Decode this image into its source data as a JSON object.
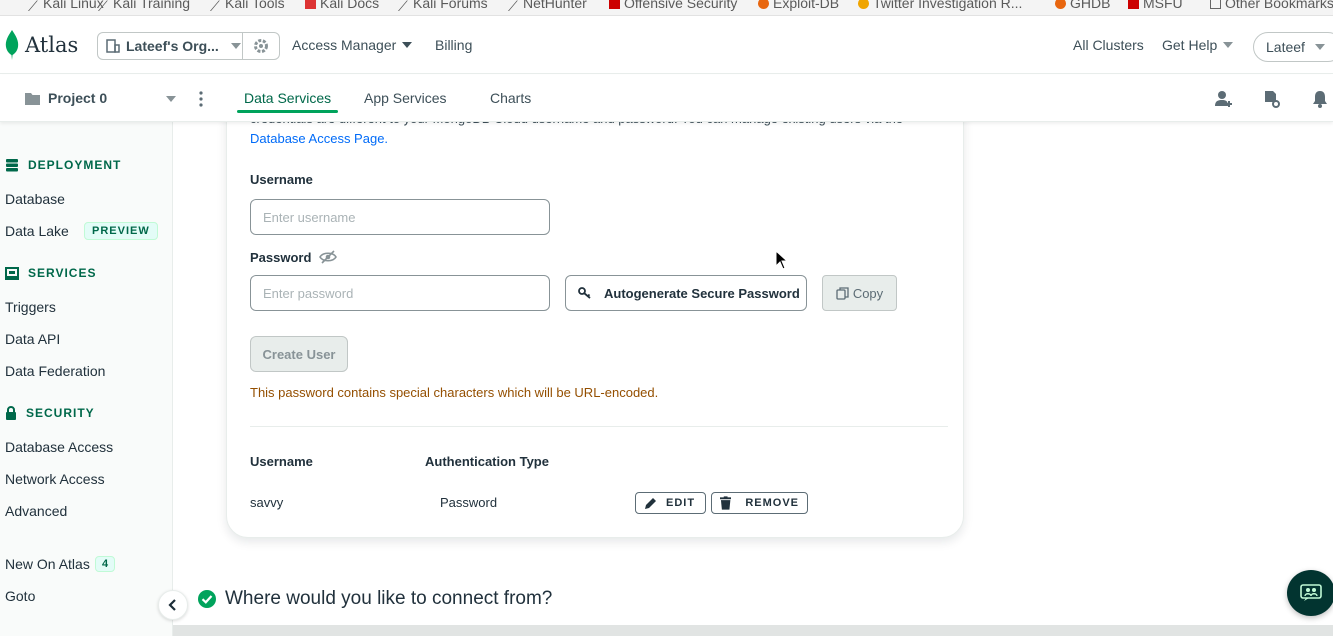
{
  "bookmarks": [
    {
      "label": "Kali Linux",
      "icon": "kali-dragon-icon"
    },
    {
      "label": "Kali Training",
      "icon": "kali-dragon-icon"
    },
    {
      "label": "Kali Tools",
      "icon": "kali-dragon-icon"
    },
    {
      "label": "Kali Docs",
      "icon": "kali-docs-icon"
    },
    {
      "label": "Kali Forums",
      "icon": "kali-dragon-icon"
    },
    {
      "label": "NetHunter",
      "icon": "nethunter-icon"
    },
    {
      "label": "Offensive Security",
      "icon": "offsec-icon"
    },
    {
      "label": "Exploit-DB",
      "icon": "exploitdb-icon"
    },
    {
      "label": "Twitter Investigation R...",
      "icon": "bookmark-icon"
    },
    {
      "label": "GHDB",
      "icon": "exploitdb-icon"
    },
    {
      "label": "MSFU",
      "icon": "offsec-icon"
    },
    {
      "label": "Other Bookmarks",
      "icon": "folder-icon"
    }
  ],
  "topnav": {
    "logo": "Atlas",
    "org": "Lateef's Org...",
    "access_manager": "Access Manager",
    "billing": "Billing",
    "all_clusters": "All Clusters",
    "get_help": "Get Help",
    "user": "Lateef"
  },
  "subnav": {
    "project": "Project 0",
    "tabs": [
      "Data Services",
      "App Services",
      "Charts"
    ]
  },
  "sidebar": {
    "deployment": {
      "title": "DEPLOYMENT",
      "items": [
        "Database",
        "Data Lake"
      ],
      "badge": "PREVIEW"
    },
    "services": {
      "title": "SERVICES",
      "items": [
        "Triggers",
        "Data API",
        "Data Federation"
      ]
    },
    "security": {
      "title": "SECURITY",
      "items": [
        "Database Access",
        "Network Access",
        "Advanced"
      ]
    },
    "extra": {
      "new_on_atlas": "New On Atlas",
      "new_count": "4",
      "goto": "Goto"
    }
  },
  "form": {
    "intro_text": "credentials are different to your MongoDB Cloud username and password. You can manage existing users via the",
    "db_access_link": "Database Access Page.",
    "username_label": "Username",
    "username_placeholder": "Enter username",
    "password_label": "Password",
    "password_placeholder": "Enter password",
    "autogenerate": "Autogenerate Secure Password",
    "copy": "Copy",
    "create_user": "Create User",
    "warning": "This password contains special characters which will be URL-encoded."
  },
  "users_table": {
    "headers": [
      "Username",
      "Authentication Type"
    ],
    "rows": [
      {
        "username": "savvy",
        "auth_type": "Password",
        "edit": "EDIT",
        "remove": "REMOVE"
      }
    ]
  },
  "connect_heading": "Where would you like to connect from?",
  "colors": {
    "accent": "#00684a",
    "link": "#016bf8",
    "warning": "#944f01",
    "success": "#00a35c"
  }
}
